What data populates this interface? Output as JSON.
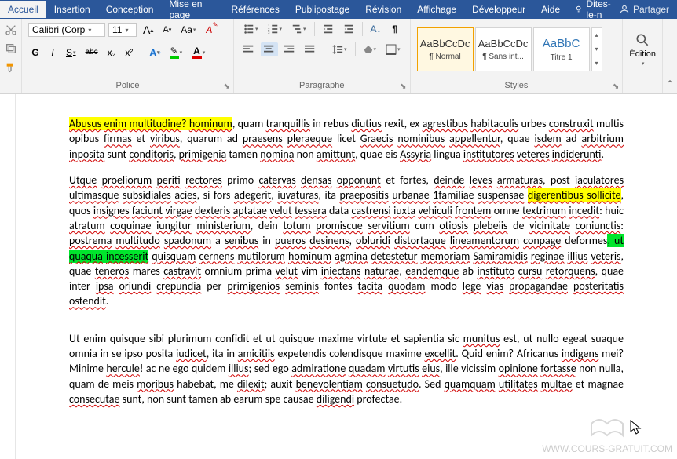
{
  "tabs": {
    "accueil": "Accueil",
    "insertion": "Insertion",
    "conception": "Conception",
    "mise_en_page": "Mise en page",
    "references": "Références",
    "publipostage": "Publipostage",
    "revision": "Révision",
    "affichage": "Affichage",
    "developpeur": "Développeur",
    "aide": "Aide",
    "tell_me": "Dites-le-n",
    "partager": "Partager"
  },
  "font": {
    "family": "Calibri (Corp",
    "size": "11",
    "bold": "G",
    "italic": "I",
    "underline": "S",
    "strike": "abc",
    "subscript": "x₂",
    "superscript": "x²",
    "grow": "A",
    "aa": "Aa",
    "clear": "A",
    "effects": "A",
    "fontcolor": "A"
  },
  "groups": {
    "police": "Police",
    "paragraphe": "Paragraphe",
    "styles": "Styles",
    "edition": "Édition"
  },
  "styles": {
    "normal_preview": "AaBbCcDc",
    "normal": "¶ Normal",
    "sansint_preview": "AaBbCcDc",
    "sansint": "¶ Sans int...",
    "titre1_preview": "AaBbC",
    "titre1": "Titre 1"
  },
  "doc": {
    "p1_h1": "Abusus",
    "p1_a": " ",
    "p1_h2": "enim",
    "p1_b": " ",
    "p1_h3": "multitudine",
    "p1_c": "? ",
    "p1_h4": "hominum",
    "p1_d": ", quam ",
    "p1_w1": "tranquillis",
    "p1_e": " in rebus ",
    "p1_w2": "diutius",
    "p1_f": " rexit, ex ",
    "p1_w3": "agrestibus",
    "p1_g": " ",
    "p1_w4": "habitaculis",
    "p1_h": " urbes ",
    "p1_w5": "construxit",
    "p1_i": " multis opibus ",
    "p1_w6": "firmas",
    "p1_j": " et ",
    "p1_w7": "viribus",
    "p1_k": ", quarum ad ",
    "p1_w8": "praesens",
    "p1_l": " ",
    "p1_w9": "pleraeque",
    "p1_m": " licet ",
    "p1_w10": "Graecis",
    "p1_n": " ",
    "p1_w11": "nominibus",
    "p1_o": " ",
    "p1_w12": "appellentur",
    "p1_p": ", quae ",
    "p1_w13": "isdem",
    "p1_q": " ad ",
    "p1_w14": "arbitrium",
    "p1_r": " ",
    "p1_w15": "inposita",
    "p1_s": " sunt ",
    "p1_w16": "conditoris",
    "p1_t": ", ",
    "p1_w17": "primigenia",
    "p1_u": " tamen ",
    "p1_w18": "nomina",
    "p1_v": " non ",
    "p1_w19": "amittunt",
    "p1_w": ", quae eis ",
    "p1_w20": "Assyria",
    "p1_x": " lingua ",
    "p1_w21": "institutores",
    "p1_y": " ",
    "p1_w22": "veteres",
    "p1_z": " ",
    "p1_w23": "indiderunti",
    "p1_end": ".",
    "p2_a": "Utque",
    "p2_b": " ",
    "p2_w1": "proeliorum",
    "p2_c": " ",
    "p2_w2": "periti",
    "p2_d": " ",
    "p2_w3": "rectores",
    "p2_e": " primo ",
    "p2_w4": "catervas",
    "p2_f": " ",
    "p2_w5": "densas",
    "p2_g": " ",
    "p2_w6": "opponunt",
    "p2_h": " et fortes, ",
    "p2_w7": "deinde",
    "p2_i": " ",
    "p2_w8": "leves",
    "p2_j": " ",
    "p2_w9": "armaturas",
    "p2_k": ", post ",
    "p2_w10": "iaculatores",
    "p2_l": " ",
    "p2_w11": "ultimasque",
    "p2_m": " ",
    "p2_w12": "subsidiales",
    "p2_n": " ",
    "p2_w13": "acies",
    "p2_o": ", si fors ",
    "p2_w14": "adegerit",
    "p2_p": ", ",
    "p2_w15": "iuvaturas",
    "p2_q": ", ita ",
    "p2_w16": "praepositis",
    "p2_r": " ",
    "p2_w17": "urbanae",
    "p2_s": " ",
    "p2_w18": "1familiae",
    "p2_t": " ",
    "p2_w19": "suspensae",
    "p2_u": " ",
    "p2_h2a": "digerentibus",
    "p2_h2b": " ",
    "p2_h2c": "sollicite",
    "p2_v": ", quos ",
    "p2_w20": "insignes",
    "p2_w": " ",
    "p2_w21": "faciunt",
    "p2_x": " ",
    "p2_w22": "virgae",
    "p2_y": " ",
    "p2_w23": "dexteris",
    "p2_z": " ",
    "p2_w24": "aptatae",
    "p2_aa": " ",
    "p2_w25": "velut",
    "p2_ab": " ",
    "p2_w26": "tessera",
    "p2_ac": " data ",
    "p2_w27": "castrensi",
    "p2_ad": " ",
    "p2_w28": "iuxta",
    "p2_ae": " ",
    "p2_w29": "vehiculi",
    "p2_af": " ",
    "p2_w30": "frontem",
    "p2_ag": " omne ",
    "p2_w31": "textrinum",
    "p2_ah": " ",
    "p2_w32": "incedit",
    "p2_ai": ": huic ",
    "p2_w33": "atratum",
    "p2_aj": " ",
    "p2_w34": "coquinae",
    "p2_ak": " ",
    "p2_w35": "iungitur",
    "p2_al": " ",
    "p2_w36": "ministerium",
    "p2_am": ", dein ",
    "p2_w37": "totum",
    "p2_an": " ",
    "p2_w38": "promiscue",
    "p2_ao": " ",
    "p2_w39": "servitium",
    "p2_ap": " cum ",
    "p2_w40": "otiosis",
    "p2_aq": " ",
    "p2_w41": "plebeiis",
    "p2_ar": " de ",
    "p2_w42": "vicinitate",
    "p2_as": " ",
    "p2_w43": "coniunctis",
    "p2_at": ": ",
    "p2_w44": "postrema",
    "p2_au": " ",
    "p2_w45": "multitudo",
    "p2_av": " ",
    "p2_w46": "spadonum",
    "p2_aw": " a ",
    "p2_w47": "senibus",
    "p2_ax": " in ",
    "p2_w48": "pueros",
    "p2_ay": " ",
    "p2_w49": "desinens",
    "p2_az": ", ",
    "p2_w50": "obluridi",
    "p2_ba": " ",
    "p2_w51": "distortaque",
    "p2_bb": " ",
    "p2_w52": "lineamentorum",
    "p2_bc": " ",
    "p2_w53": "conpage",
    "p2_bd": " deformes",
    "p2_be": ", ",
    "p2_h3a": "ut ",
    "p2_h3b": "quaqua",
    "p2_h3c": " ",
    "p2_h3d": "incesserit",
    "p2_bf": " ",
    "p2_w54": "quisquam",
    "p2_bg": " ",
    "p2_w55": "cernens",
    "p2_bh": " ",
    "p2_w56": "mutilorum",
    "p2_bi": " ",
    "p2_w57": "hominum",
    "p2_bj": " ",
    "p2_w58": "agmina",
    "p2_bk": " ",
    "p2_w59": "detestetur",
    "p2_bl": " ",
    "p2_w60": "memoriam",
    "p2_bm": " ",
    "p2_w61": "Samiramidis",
    "p2_bn": " ",
    "p2_w62": "reginae",
    "p2_bo": " ",
    "p2_w63": "illius",
    "p2_bp": " ",
    "p2_w64": "veteris",
    "p2_bq": ", quae ",
    "p2_w65": "teneros",
    "p2_br": " mares ",
    "p2_w66": "castravit",
    "p2_bs": " omnium prima ",
    "p2_w67": "velut",
    "p2_bt": " vim ",
    "p2_w68": "iniectans",
    "p2_bu": " ",
    "p2_w69": "naturae",
    "p2_bv": ", ",
    "p2_w70": "eandemque",
    "p2_bw": " ab ",
    "p2_w71": "instituto",
    "p2_bx": " ",
    "p2_w72": "cursu",
    "p2_by": " ",
    "p2_w73": "retorquens",
    "p2_bz": ", quae inter ",
    "p2_w74": "ipsa",
    "p2_ca": " ",
    "p2_w75": "oriundi",
    "p2_cb": " ",
    "p2_w76": "crepundia",
    "p2_cc": " per ",
    "p2_w77": "primigenios",
    "p2_cd": " ",
    "p2_w78": "seminis",
    "p2_ce": " fontes ",
    "p2_w79": "tacita",
    "p2_cf": " ",
    "p2_w80": "quodam",
    "p2_cg": " modo ",
    "p2_w81": "lege",
    "p2_ch": " ",
    "p2_w82": "vias",
    "p2_ci": " ",
    "p2_w83": "propagandae",
    "p2_cj": " ",
    "p2_w84": "posteritatis",
    "p2_ck": " ",
    "p2_w85": "ostendit",
    "p2_end": ".",
    "p3_a": "Ut enim quisque sibi plurimum confidit et ut quisque maxime virtute et sapientia sic ",
    "p3_w1": "munitus",
    "p3_b": " est, ut nullo egeat suaque omnia in se ipso posita ",
    "p3_w2": "iudicet",
    "p3_c": ", ita in ",
    "p3_w3": "amicitiis",
    "p3_d": " expetendis colendisque maxime ",
    "p3_w4": "excellit",
    "p3_e": ". Quid enim? Africanus ",
    "p3_w5": "indigens",
    "p3_f": " mei? Minime ",
    "p3_w6": "hercule",
    "p3_g": "! ac ne ego quidem ",
    "p3_w7": "illius",
    "p3_h": "; sed ego ",
    "p3_w8": "admiratione",
    "p3_i": " ",
    "p3_w9": "quadam",
    "p3_j": " ",
    "p3_w10": "virtutis",
    "p3_k": " ",
    "p3_w11": "eius",
    "p3_l": ", ille vicissim ",
    "p3_w12": "opinione",
    "p3_m": " ",
    "p3_w13": "fortasse",
    "p3_n": " non nulla, quam de meis ",
    "p3_w14": "moribus",
    "p3_o": " habebat, me ",
    "p3_w15": "dilexit",
    "p3_p": "; auxit ",
    "p3_w16": "benevolentiam",
    "p3_q": " ",
    "p3_w17": "consuetudo",
    "p3_r": ". Sed ",
    "p3_w18": "quamquam",
    "p3_s": " ",
    "p3_w19": "utilitates",
    "p3_t": " ",
    "p3_w20": "multae",
    "p3_u": " et magnae ",
    "p3_w21": "consecutae",
    "p3_v": " sunt, non sunt tamen ab earum spe causae ",
    "p3_w22": "diligendi",
    "p3_w": " profectae."
  },
  "watermark": "WWW.COURS-GRATUIT.COM"
}
